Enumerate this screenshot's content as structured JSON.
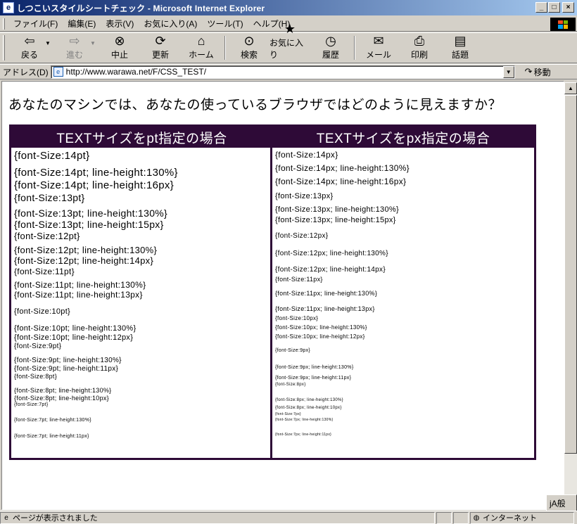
{
  "window": {
    "title": "しつこいスタイルシートチェック - Microsoft Internet Explorer",
    "minimize_glyph": "_",
    "maximize_glyph": "□",
    "close_glyph": "×"
  },
  "menu": [
    "ファイル(F)",
    "編集(E)",
    "表示(V)",
    "お気に入り(A)",
    "ツール(T)",
    "ヘルプ(H)"
  ],
  "toolbar": [
    {
      "label": "戻る",
      "icon": "back-arrow-icon",
      "glyph": "⇦",
      "enabled": true
    },
    {
      "label": "進む",
      "icon": "forward-arrow-icon",
      "glyph": "⇨",
      "enabled": false
    },
    {
      "label": "中止",
      "icon": "stop-icon",
      "glyph": "⊗",
      "enabled": true
    },
    {
      "label": "更新",
      "icon": "refresh-icon",
      "glyph": "⟳",
      "enabled": true
    },
    {
      "label": "ホーム",
      "icon": "home-icon",
      "glyph": "⌂",
      "enabled": true
    },
    {
      "label": "検索",
      "icon": "search-icon",
      "glyph": "⊙",
      "enabled": true
    },
    {
      "label": "お気に入り",
      "icon": "favorites-icon",
      "glyph": "★",
      "enabled": true
    },
    {
      "label": "履歴",
      "icon": "history-icon",
      "glyph": "◷",
      "enabled": true
    },
    {
      "label": "メール",
      "icon": "mail-icon",
      "glyph": "✉",
      "enabled": true
    },
    {
      "label": "印刷",
      "icon": "print-icon",
      "glyph": "⎙",
      "enabled": true
    },
    {
      "label": "話題",
      "icon": "discuss-icon",
      "glyph": "▤",
      "enabled": true
    }
  ],
  "address": {
    "label": "アドレス(D)",
    "url": "http://www.warawa.net/F/CSS_TEST/",
    "go_label": "移動"
  },
  "page": {
    "heading": "あなたのマシンでは、あなたの使っているブラウザではどのように見えますか？",
    "table": {
      "header_pt": "TEXTサイズをpt指定の場合",
      "header_px": "TEXTサイズをpx指定の場合",
      "pt_lines": [
        {
          "text": "{font-Size:14pt}",
          "size": "15px",
          "lh": "20px",
          "mb": "4px"
        },
        {
          "text": "{font-Size:14pt; line-height:130%}",
          "size": "15px",
          "lh": "20px",
          "mb": "0px"
        },
        {
          "text": "{font-Size:14pt; line-height:16px}",
          "size": "15px",
          "lh": "16px",
          "mb": "0px"
        },
        {
          "text": "{font-Size:13pt}",
          "size": "14px",
          "lh": "19px",
          "mb": "3px"
        },
        {
          "text": "{font-Size:13pt; line-height:130%}",
          "size": "14px",
          "lh": "18px",
          "mb": "0px"
        },
        {
          "text": "{font-Size:13pt; line-height:15px}",
          "size": "14px",
          "lh": "15px",
          "mb": "0px"
        },
        {
          "text": "{font-Size:12pt}",
          "size": "13px",
          "lh": "17px",
          "mb": "3px"
        },
        {
          "text": "{font-Size:12pt; line-height:130%}",
          "size": "13px",
          "lh": "17px",
          "mb": "0px"
        },
        {
          "text": "{font-Size:12pt; line-height:14px}",
          "size": "13px",
          "lh": "14px",
          "mb": "0px"
        },
        {
          "text": "{font-Size:11pt}",
          "size": "12px",
          "lh": "16px",
          "mb": "3px"
        },
        {
          "text": "{font-Size:11pt; line-height:130%}",
          "size": "12px",
          "lh": "16px",
          "mb": "0px"
        },
        {
          "text": "{font-Size:11pt; line-height:13px}",
          "size": "12px",
          "lh": "13px",
          "mb": "10px"
        },
        {
          "text": "{font-Size:10pt}",
          "size": "11px",
          "lh": "14px",
          "mb": "10px"
        },
        {
          "text": "{font-Size:10pt; line-height:130%}",
          "size": "11px",
          "lh": "14px",
          "mb": "0px"
        },
        {
          "text": "{font-Size:10pt; line-height:12px}",
          "size": "11px",
          "lh": "12px",
          "mb": "0px"
        },
        {
          "text": "{font-Size:9pt}",
          "size": "10px",
          "lh": "13px",
          "mb": "7px"
        },
        {
          "text": "{font-Size:9pt; line-height:130%}",
          "size": "10px",
          "lh": "13px",
          "mb": "0px"
        },
        {
          "text": "{font-Size:9pt; line-height:11px}",
          "size": "10px",
          "lh": "11px",
          "mb": "0px"
        },
        {
          "text": "{font-Size:8pt}",
          "size": "9px",
          "lh": "11px",
          "mb": "9px"
        },
        {
          "text": "{font-Size:8pt; line-height:130%}",
          "size": "9px",
          "lh": "11px",
          "mb": "0px"
        },
        {
          "text": "{font-Size:8pt; line-height:10px}",
          "size": "9px",
          "lh": "10px",
          "mb": "0px"
        },
        {
          "text": "{font-Size:7pt}",
          "size": "7px",
          "lh": "10px",
          "mb": "12px"
        },
        {
          "text": "{font-Size:7pt; line-height:130%}",
          "size": "7px",
          "lh": "10px",
          "mb": "12px"
        },
        {
          "text": "{font-Size:7pt; line-height:11px}",
          "size": "7px",
          "lh": "11px",
          "mb": "0px"
        }
      ],
      "px_lines": [
        {
          "text": "{font-Size:14px}",
          "size": "12px",
          "lh": "17px",
          "mb": "2px"
        },
        {
          "text": "{font-Size:14px; line-height:130%}",
          "size": "12px",
          "lh": "17px",
          "mb": "2px"
        },
        {
          "text": "{font-Size:14px; line-height:16px}",
          "size": "12px",
          "lh": "16px",
          "mb": "5px"
        },
        {
          "text": "{font-Size:13px}",
          "size": "11px",
          "lh": "16px",
          "mb": "3px"
        },
        {
          "text": "{font-Size:13px; line-height:130%}",
          "size": "11px",
          "lh": "16px",
          "mb": "0px"
        },
        {
          "text": "{font-Size:13px; line-height:15px}",
          "size": "11px",
          "lh": "15px",
          "mb": "7px"
        },
        {
          "text": "{font-Size:12px}",
          "size": "10px",
          "lh": "15px",
          "mb": "10px"
        },
        {
          "text": "{font-Size:12px; line-height:130%}",
          "size": "10px",
          "lh": "15px",
          "mb": "9px"
        },
        {
          "text": "{font-Size:12px; line-height:14px}",
          "size": "10px",
          "lh": "14px",
          "mb": "0px"
        },
        {
          "text": "{font-Size:11px}",
          "size": "9px",
          "lh": "12px",
          "mb": "8px"
        },
        {
          "text": "{font-Size:11px; line-height:130%}",
          "size": "9px",
          "lh": "12px",
          "mb": "10px"
        },
        {
          "text": "{font-Size:11px; line-height:13px}",
          "size": "9px",
          "lh": "13px",
          "mb": "1px"
        },
        {
          "text": "{font-Size:10px}",
          "size": "8px",
          "lh": "12px",
          "mb": "0px"
        },
        {
          "text": "{font-Size:10px; line-height:130%}",
          "size": "8px",
          "lh": "13px",
          "mb": "0px"
        },
        {
          "text": "{font-Size:10px; line-height:12px}",
          "size": "8px",
          "lh": "13px",
          "mb": "8px"
        },
        {
          "text": "{font-Size:9px}",
          "size": "7px",
          "lh": "11px",
          "mb": "13px"
        },
        {
          "text": "{font-Size:9px; line-height:130%}",
          "size": "7px",
          "lh": "11px",
          "mb": "4px"
        },
        {
          "text": "{font-Size:9px; line-height:11px}",
          "size": "7px",
          "lh": "11px",
          "mb": "0px"
        },
        {
          "text": "{font-Size:8px}",
          "size": "6px",
          "lh": "9px",
          "mb": "11px"
        },
        {
          "text": "{font-Size:8px; line-height:130%}",
          "size": "6px",
          "lh": "12px",
          "mb": "0px"
        },
        {
          "text": "{font-Size:8px; line-height:10px}",
          "size": "6px",
          "lh": "10px",
          "mb": "0px"
        },
        {
          "text": "{font-Size:7px}",
          "size": "5px",
          "lh": "8px",
          "mb": "0px"
        },
        {
          "text": "{font-Size:7px; line-height:130%}",
          "size": "5px",
          "lh": "9px",
          "mb": "11px"
        },
        {
          "text": "{font-Size:7px; line-height:11px}",
          "size": "5px",
          "lh": "11px",
          "mb": "0px"
        }
      ]
    }
  },
  "status": {
    "text": "ページが表示されました",
    "zone": "インターネット"
  },
  "ime": {
    "label": "jA般"
  },
  "colors": {
    "table_border": "#2e0a37",
    "titlebar_start": "#0a246a",
    "titlebar_end": "#a6caf0"
  }
}
